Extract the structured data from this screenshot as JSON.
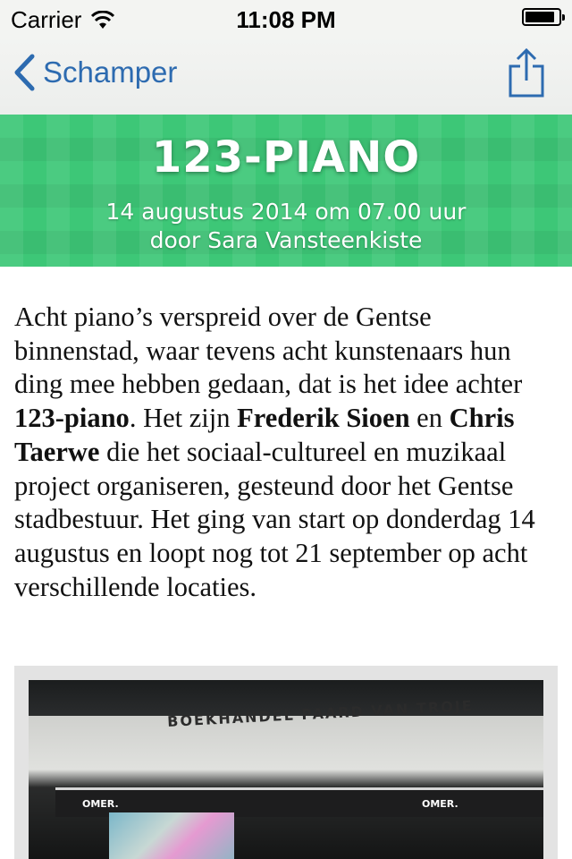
{
  "status_bar": {
    "carrier": "Carrier",
    "time": "11:08 PM",
    "battery_level": 0.9
  },
  "nav": {
    "back_label": "Schamper",
    "back_icon": "chevron-left-icon",
    "share_icon": "share-icon",
    "tint_color": "#2d6bb0"
  },
  "header": {
    "title": "123-PIANO",
    "date": "14 augustus 2014 om 07.00 uur",
    "author": "door Sara Vansteenkiste",
    "background_color": "#3dc777"
  },
  "article": {
    "segments": [
      {
        "text": "Acht piano’s verspreid over de Gentse binnenstad, waar tevens acht kunstenaars hun ding mee hebben gedaan, dat is het idee achter ",
        "bold": false
      },
      {
        "text": "123-piano",
        "bold": true
      },
      {
        "text": ". Het zijn ",
        "bold": false
      },
      {
        "text": "Frederik Sioen",
        "bold": true
      },
      {
        "text": " en ",
        "bold": false
      },
      {
        "text": "Chris Taerwe",
        "bold": true
      },
      {
        "text": " die het sociaal-cultureel en muzikaal project organiseren, gesteund door het Gentse stadbestuur. Het ging van start op donderdag 14 augustus en loopt nog tot 21 september op acht verschillende locaties.",
        "bold": false
      }
    ]
  },
  "photo": {
    "sign_text": "BOEKHANDEL PAARD VAN TROJE",
    "awning_text_left": "OMER.",
    "awning_text_right": "OMER."
  }
}
